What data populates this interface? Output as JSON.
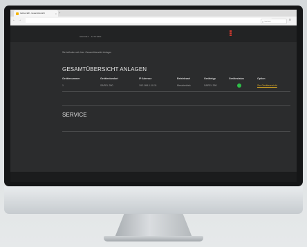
{
  "browser": {
    "tab_title": "Gefinex ERI - Gesamtübersicht",
    "tab_close": "×",
    "new_tab": "+",
    "back": "←",
    "forward": "→",
    "search_placeholder": "Suchen",
    "menu_icon": "≡"
  },
  "site": {
    "brand": "GEFINEX · SYSTEMS",
    "welcome": "Sie befinden sich hier: Gesamtübersicht Anlagen"
  },
  "overview": {
    "title": "GESAMTÜBERSICHT ANLAGEN",
    "columns": [
      "Gerätenummer",
      "Gerätestandort",
      "IP Adresse",
      "Betriebsart",
      "Gerätetyp",
      "Gerätestatus",
      "Option"
    ],
    "rows": [
      {
        "number": "1",
        "location": "SAPEL 350",
        "ip": "192.168.1.10.11",
        "mode": "Messbetrieb",
        "type": "SAPEL 350",
        "status": "online",
        "option": "Zur Geräteansicht"
      }
    ],
    "status_color": "#2ebf48"
  },
  "service": {
    "title": "SERVICE"
  },
  "colors": {
    "background": "#2b2c2d",
    "accent": "#e6b122",
    "status_ok": "#2ebf48",
    "header_accent": "#d33a2f"
  }
}
